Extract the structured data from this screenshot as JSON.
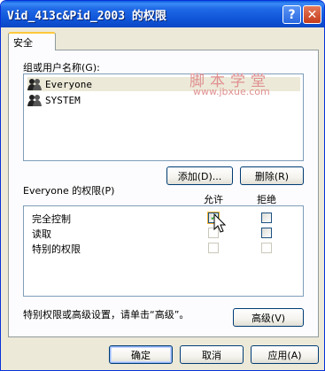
{
  "window": {
    "title": "Vid_413c&Pid_2003 的权限",
    "help_glyph": "?",
    "close_glyph": "✕"
  },
  "tabs": [
    {
      "label": "安全",
      "active": true
    }
  ],
  "security": {
    "group_label": "组或用户名称(G):",
    "users": [
      {
        "name": "Everyone",
        "selected": true,
        "icon": "users-group-icon"
      },
      {
        "name": "SYSTEM",
        "selected": false,
        "icon": "users-group-icon"
      }
    ],
    "add_button": "添加(D)...",
    "remove_button": "删除(R)",
    "perm_label": "Everyone 的权限(P)",
    "col_allow": "允许",
    "col_deny": "拒绝",
    "permissions": [
      {
        "name": "完全控制",
        "allow": true,
        "allow_enabled": true,
        "deny": false,
        "deny_enabled": true
      },
      {
        "name": "读取",
        "allow": false,
        "allow_enabled": false,
        "deny": false,
        "deny_enabled": true
      },
      {
        "name": "特别的权限",
        "allow": false,
        "allow_enabled": false,
        "deny": false,
        "deny_enabled": false
      }
    ],
    "advanced_hint": "特别权限或高级设置，请单击“高级”。",
    "advanced_button": "高级(V)"
  },
  "watermark": {
    "line1": "脚本学堂",
    "line2": "www.jbxue.com"
  },
  "footer": {
    "ok": "确定",
    "cancel": "取消",
    "apply": "应用(A)"
  },
  "colors": {
    "titlebar": "#0a5ddf",
    "face": "#ece9d8",
    "tab_highlight": "#ffc83c",
    "watermark": "#e09090"
  }
}
